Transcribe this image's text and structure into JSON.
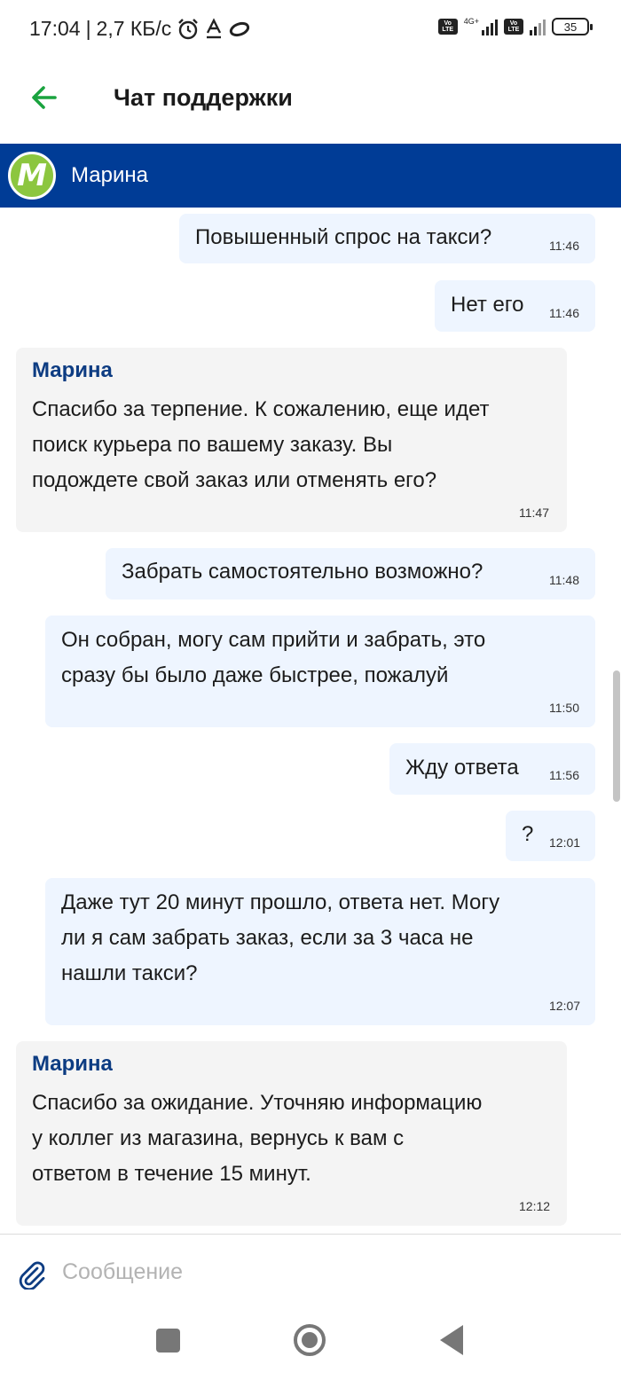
{
  "status_bar": {
    "time": "17:04",
    "speed": "2,7 КБ/с",
    "network_label": "4G+",
    "volte_label": "Vo LTE",
    "battery": "35"
  },
  "app_bar": {
    "title": "Чат поддержки",
    "back_icon": "arrow-left-icon",
    "back_color": "#1aa33f"
  },
  "operator": {
    "name": "Марина",
    "avatar_letter": "M",
    "avatar_color": "#8cc63f",
    "bar_color": "#003c96"
  },
  "messages": [
    {
      "direction": "out",
      "text": "Повышенный спрос на такси?",
      "time": "11:46"
    },
    {
      "direction": "out",
      "text": "Нет его",
      "time": "11:46"
    },
    {
      "direction": "in",
      "sender": "Марина",
      "lines": [
        "Спасибо за терпение. К сожалению, еще идет",
        "поиск курьера по вашему заказу. Вы",
        "подождете свой заказ или отменять его?"
      ],
      "time": "11:47"
    },
    {
      "direction": "out",
      "text": "Забрать самостоятельно возможно?",
      "time": "11:48"
    },
    {
      "direction": "out",
      "lines": [
        "Он собран, могу сам прийти и забрать, это",
        "сразу бы было даже быстрее, пожалуй"
      ],
      "time": "11:50"
    },
    {
      "direction": "out",
      "text": "Жду ответа",
      "time": "11:56"
    },
    {
      "direction": "out",
      "text": "?",
      "time": "12:01"
    },
    {
      "direction": "out",
      "lines": [
        "Даже тут 20 минут прошло, ответа нет. Могу",
        "ли я сам забрать заказ, если за 3 часа не",
        "нашли такси?"
      ],
      "time": "12:07"
    },
    {
      "direction": "in",
      "sender": "Марина",
      "lines": [
        "Спасибо за ожидание. Уточняю информацию",
        "у коллег из магазина, вернусь к вам с",
        "ответом в течение 15 минут."
      ],
      "time": "12:12"
    }
  ],
  "composer": {
    "placeholder": "Сообщение",
    "attach_icon": "paperclip-icon",
    "attach_color": "#0d3c82"
  },
  "nav": {
    "recents_icon": "square-icon",
    "home_icon": "circle-home-icon",
    "back_icon": "triangle-back-icon"
  }
}
